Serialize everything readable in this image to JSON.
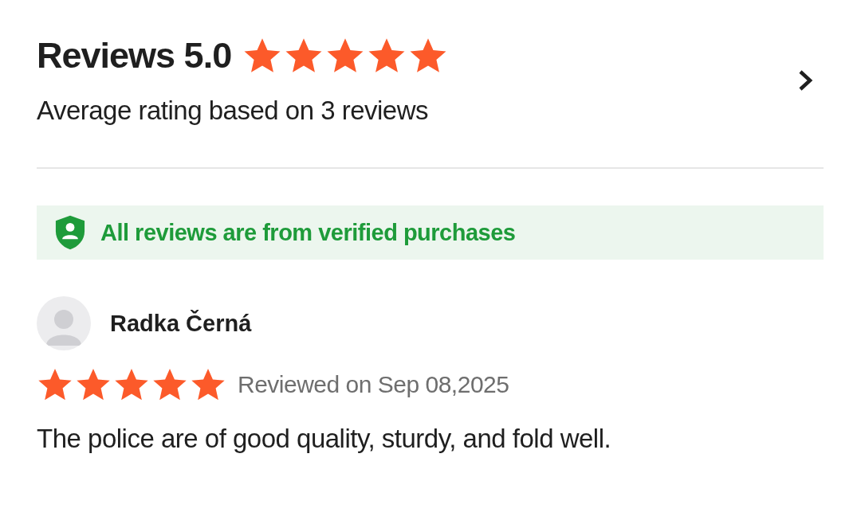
{
  "header": {
    "title": "Reviews 5.0",
    "stars": 5,
    "subtitle": "Average rating based on 3 reviews"
  },
  "verified_banner": {
    "text": "All reviews are from verified purchases"
  },
  "reviews": [
    {
      "author": "Radka Černá",
      "stars": 5,
      "date": "Reviewed on Sep 08,2025",
      "text": "The police are of good quality, sturdy, and fold well."
    }
  ]
}
